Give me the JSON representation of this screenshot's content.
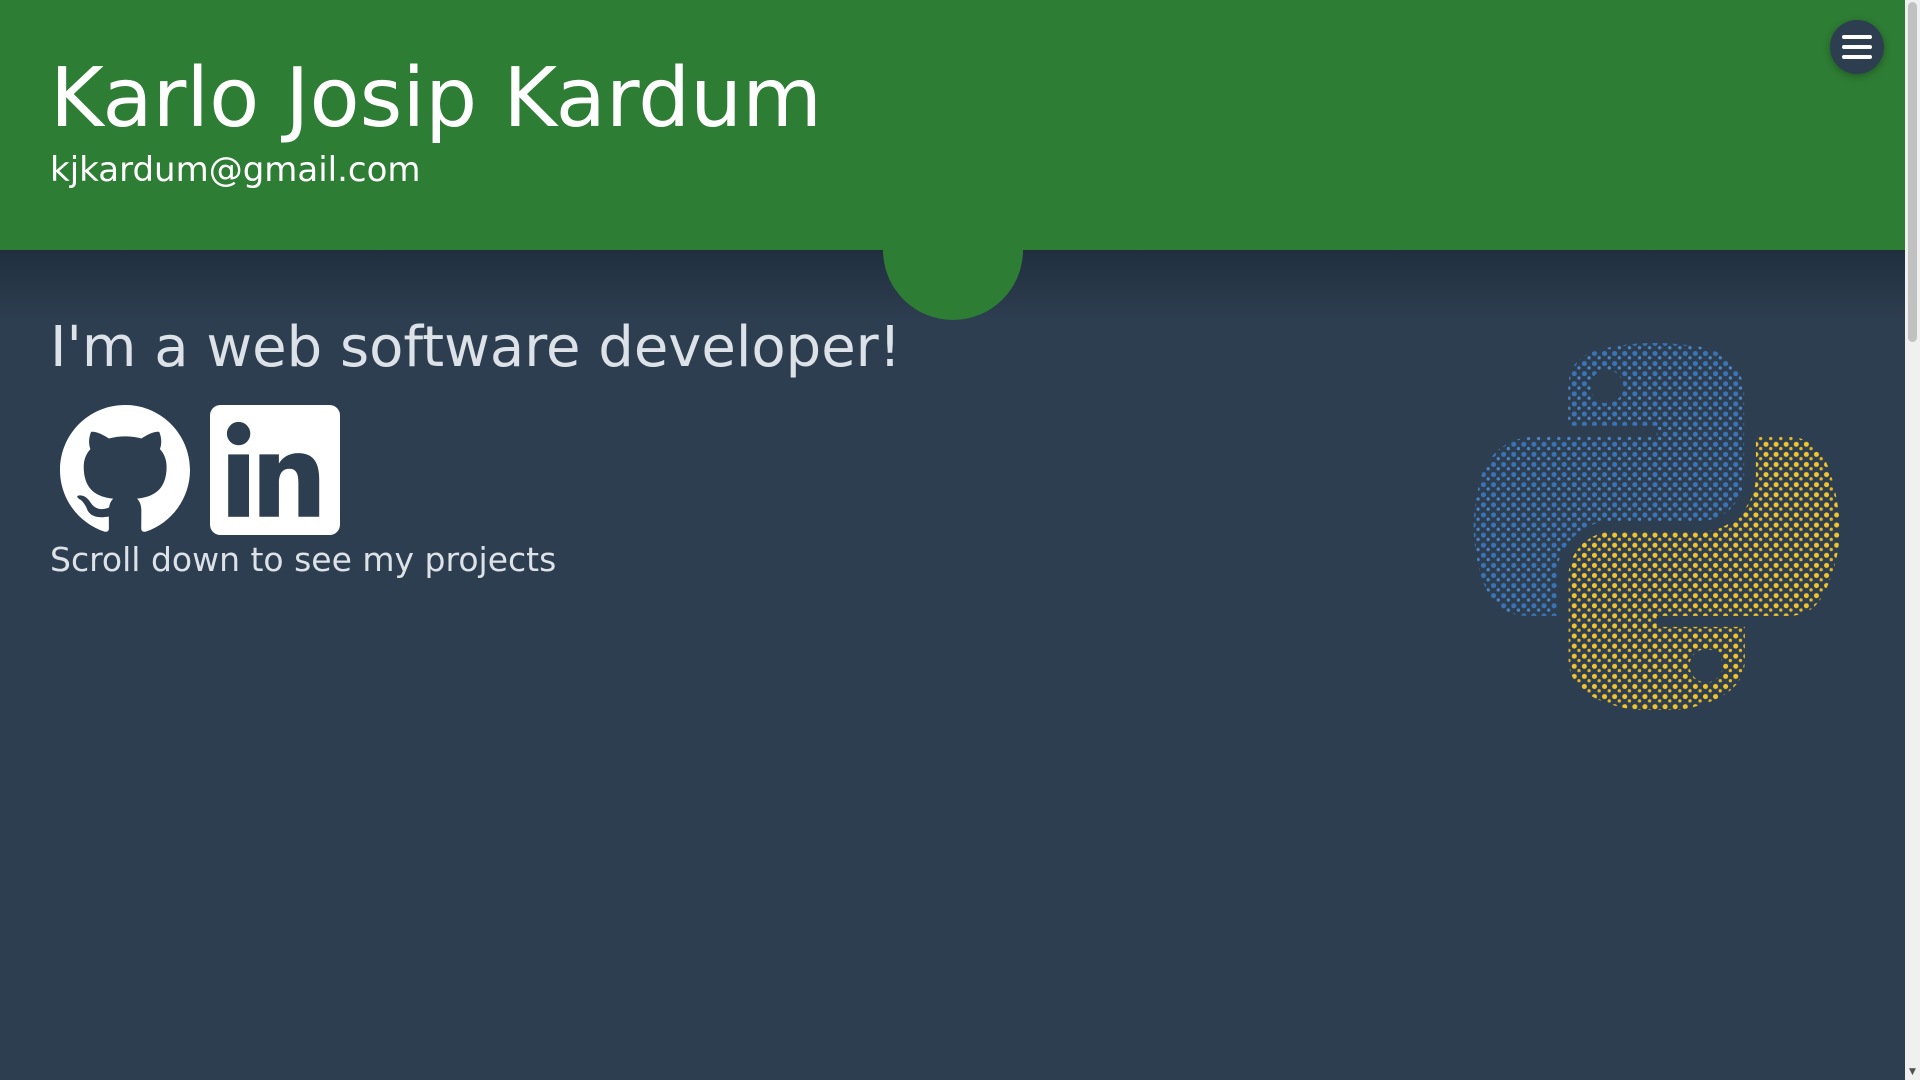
{
  "header": {
    "name": "Karlo Josip Kardum",
    "email": "kjkardum@gmail.com"
  },
  "menu": {
    "icon": "hamburger-menu-icon"
  },
  "hero": {
    "tagline": "I'm a web software developer!",
    "scroll_hint": "Scroll down to see my projects"
  },
  "social": {
    "github_icon": "github-icon",
    "linkedin_icon": "linkedin-icon"
  },
  "decoration": {
    "logo_icon": "python-logo-icon"
  },
  "colors": {
    "header_green": "#2e7d34",
    "page_background": "#2d3e50",
    "python_blue": "#3a74b8",
    "python_yellow": "#f2c42a"
  }
}
